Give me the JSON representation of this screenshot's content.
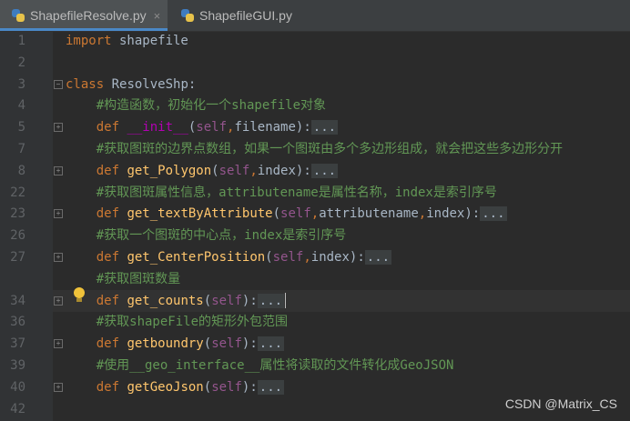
{
  "tabs": [
    {
      "label": "ShapefileResolve.py",
      "active": true
    },
    {
      "label": "ShapefileGUI.py",
      "active": false
    }
  ],
  "tab_close_glyph": "×",
  "lines": [
    {
      "num": "1",
      "segments": [
        {
          "t": "import",
          "c": "kw"
        },
        {
          "t": " shapefile",
          "c": ""
        }
      ]
    },
    {
      "num": "2",
      "segments": []
    },
    {
      "num": "3",
      "segments": [
        {
          "t": "class",
          "c": "kw"
        },
        {
          "t": " ResolveShp:",
          "c": ""
        }
      ]
    },
    {
      "num": "4",
      "segments": [
        {
          "t": "    ",
          "c": ""
        },
        {
          "t": "#构造函数，初始化一个shapefile对象",
          "c": "cm"
        }
      ]
    },
    {
      "num": "5",
      "segments": [
        {
          "t": "    ",
          "c": ""
        },
        {
          "t": "def",
          "c": "kw"
        },
        {
          "t": " ",
          "c": ""
        },
        {
          "t": "__init__",
          "c": "sp"
        },
        {
          "t": "(",
          "c": ""
        },
        {
          "t": "self",
          "c": "slf"
        },
        {
          "t": ",",
          "c": "kw"
        },
        {
          "t": "filename):",
          "c": ""
        },
        {
          "t": "...",
          "c": "dots"
        }
      ]
    },
    {
      "num": "7",
      "segments": [
        {
          "t": "    ",
          "c": ""
        },
        {
          "t": "#获取图斑的边界点数组，如果一个图斑由多个多边形组成，就会把这些多边形分开",
          "c": "cm"
        }
      ]
    },
    {
      "num": "8",
      "segments": [
        {
          "t": "    ",
          "c": ""
        },
        {
          "t": "def",
          "c": "kw"
        },
        {
          "t": " ",
          "c": ""
        },
        {
          "t": "get_Polygon",
          "c": "fn"
        },
        {
          "t": "(",
          "c": ""
        },
        {
          "t": "self",
          "c": "slf"
        },
        {
          "t": ",",
          "c": "kw"
        },
        {
          "t": "index):",
          "c": ""
        },
        {
          "t": "...",
          "c": "dots"
        }
      ]
    },
    {
      "num": "22",
      "segments": [
        {
          "t": "    ",
          "c": ""
        },
        {
          "t": "#获取图斑属性信息，attributename是属性名称，index是索引序号",
          "c": "cm"
        }
      ]
    },
    {
      "num": "23",
      "segments": [
        {
          "t": "    ",
          "c": ""
        },
        {
          "t": "def",
          "c": "kw"
        },
        {
          "t": " ",
          "c": ""
        },
        {
          "t": "get_textByAttribute",
          "c": "fn"
        },
        {
          "t": "(",
          "c": ""
        },
        {
          "t": "self",
          "c": "slf"
        },
        {
          "t": ",",
          "c": "kw"
        },
        {
          "t": "attributename",
          "c": ""
        },
        {
          "t": ",",
          "c": "kw"
        },
        {
          "t": "index):",
          "c": ""
        },
        {
          "t": "...",
          "c": "dots"
        }
      ]
    },
    {
      "num": "26",
      "segments": [
        {
          "t": "    ",
          "c": ""
        },
        {
          "t": "#获取一个图斑的中心点，index是索引序号",
          "c": "cm"
        }
      ]
    },
    {
      "num": "27",
      "segments": [
        {
          "t": "    ",
          "c": ""
        },
        {
          "t": "def",
          "c": "kw"
        },
        {
          "t": " ",
          "c": ""
        },
        {
          "t": "get_CenterPosition",
          "c": "fn"
        },
        {
          "t": "(",
          "c": ""
        },
        {
          "t": "self",
          "c": "slf"
        },
        {
          "t": ",",
          "c": "kw"
        },
        {
          "t": "index):",
          "c": ""
        },
        {
          "t": "...",
          "c": "dots"
        }
      ]
    },
    {
      "num": "",
      "segments": [
        {
          "t": "    ",
          "c": ""
        },
        {
          "t": "#获取图斑数量",
          "c": "cm"
        }
      ]
    },
    {
      "num": "34",
      "segments": [
        {
          "t": "    ",
          "c": ""
        },
        {
          "t": "def",
          "c": "kw"
        },
        {
          "t": " ",
          "c": ""
        },
        {
          "t": "get_counts",
          "c": "fn"
        },
        {
          "t": "(",
          "c": ""
        },
        {
          "t": "self",
          "c": "slf"
        },
        {
          "t": "):",
          "c": ""
        },
        {
          "t": "...",
          "c": "dots"
        }
      ],
      "caret": true
    },
    {
      "num": "36",
      "segments": [
        {
          "t": "    ",
          "c": ""
        },
        {
          "t": "#获取shapeFile的矩形外包范围",
          "c": "cm"
        }
      ]
    },
    {
      "num": "37",
      "segments": [
        {
          "t": "    ",
          "c": ""
        },
        {
          "t": "def",
          "c": "kw"
        },
        {
          "t": " ",
          "c": ""
        },
        {
          "t": "getboundry",
          "c": "fn"
        },
        {
          "t": "(",
          "c": ""
        },
        {
          "t": "self",
          "c": "slf"
        },
        {
          "t": "):",
          "c": ""
        },
        {
          "t": "...",
          "c": "dots"
        }
      ]
    },
    {
      "num": "39",
      "segments": [
        {
          "t": "    ",
          "c": ""
        },
        {
          "t": "#使用__geo_interface__属性将读取的文件转化成GeoJSON",
          "c": "cm"
        }
      ]
    },
    {
      "num": "40",
      "segments": [
        {
          "t": "    ",
          "c": ""
        },
        {
          "t": "def",
          "c": "kw"
        },
        {
          "t": " ",
          "c": ""
        },
        {
          "t": "getGeoJson",
          "c": "fn"
        },
        {
          "t": "(",
          "c": ""
        },
        {
          "t": "self",
          "c": "slf"
        },
        {
          "t": "):",
          "c": ""
        },
        {
          "t": "...",
          "c": "dots"
        }
      ]
    },
    {
      "num": "42",
      "segments": []
    }
  ],
  "fold_markers": [
    "5",
    "8",
    "23",
    "27",
    "34",
    "37",
    "40"
  ],
  "class_fold": "3",
  "watermark": "CSDN @Matrix_CS",
  "colors": {
    "keyword": "#cc7832",
    "function": "#ffc66d",
    "special": "#b200b2",
    "self": "#94558d",
    "comment": "#629755",
    "text": "#a9b7c6",
    "background": "#2b2b2b"
  }
}
